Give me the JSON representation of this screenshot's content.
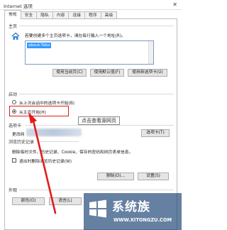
{
  "window": {
    "title": "Internet 选项"
  },
  "tabs": [
    {
      "label": "常规",
      "active": true
    },
    {
      "label": "安全"
    },
    {
      "label": "隐私"
    },
    {
      "label": "内容"
    },
    {
      "label": "连接"
    },
    {
      "label": "程序"
    },
    {
      "label": "高级"
    }
  ],
  "home": {
    "section": "主页",
    "description": "若要创建多个主页选项卡，请在每行输入一个地址(R)。",
    "url_value": "about:Tabs",
    "buttons": {
      "current": "使用当前页(C)",
      "default": "使用默认值(F)",
      "newtab": "使用新选项卡(U)"
    }
  },
  "startup": {
    "section": "启动",
    "option_last": "从上次会话中的选项卡开始(B)",
    "option_home": "从主页开始(H)",
    "selected": "option_home"
  },
  "tabs_section": {
    "section": "选项卡",
    "change_text": "更改网",
    "button": "选项卡(T)"
  },
  "history": {
    "section": "浏览历史记录",
    "description": "删除临时文件、历史记录、Cookie、保存的密码和网页表单信息。",
    "checkbox_exit": "退出时删除浏览历史记录(W)",
    "delete_button": "删除(D)...",
    "settings_button": "设置(S)"
  },
  "appearance": {
    "section": "外观",
    "colors_button": "颜色(O)",
    "languages_button": "语言(L)"
  },
  "annotation": {
    "tooltip": "点击查看源网页",
    "color": "#e21b1b"
  },
  "watermark": {
    "brand": "系统族",
    "url": "WWW.XITONGZU.COM"
  },
  "icons": {
    "home": "home-icon",
    "close": "close-icon",
    "watermark_logo": "windows-logo-icon"
  }
}
